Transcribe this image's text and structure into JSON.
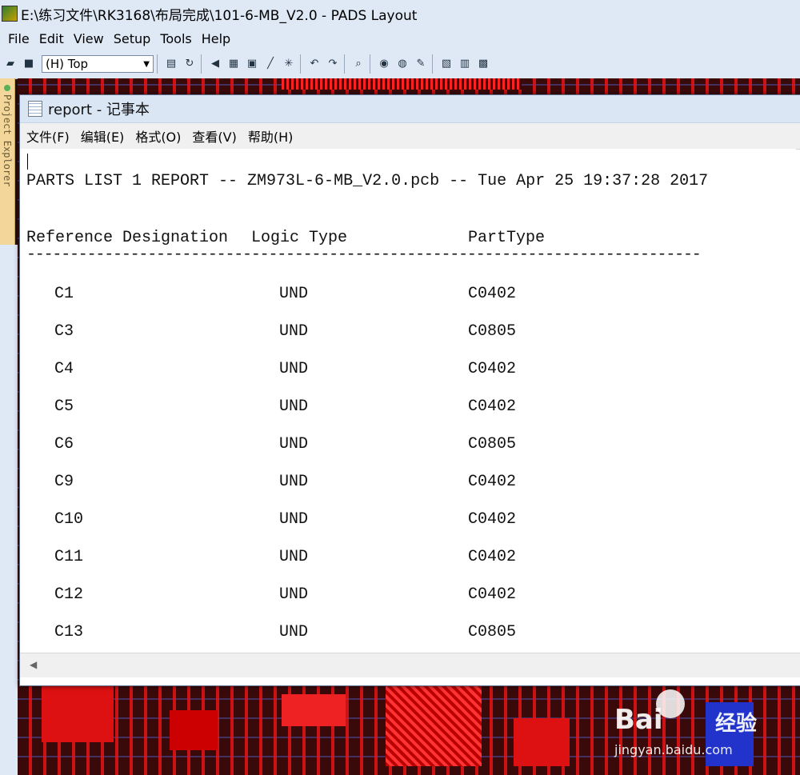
{
  "app": {
    "title": "E:\\练习文件\\RK3168\\布局完成\\101-6-MB_V2.0 - PADS Layout",
    "icon": "pads-app-icon"
  },
  "menu": {
    "file": "File",
    "edit": "Edit",
    "view": "View",
    "setup": "Setup",
    "tools": "Tools",
    "help": "Help"
  },
  "toolbar": {
    "layer_value": "(H) Top"
  },
  "project_explorer": {
    "label": "Project Explorer"
  },
  "notepad": {
    "title": "report - 记事本",
    "menu": [
      "文件(F)",
      "编辑(E)",
      "格式(O)",
      "查看(V)",
      "帮助(H)"
    ],
    "report_title": "PARTS LIST 1 REPORT -- ZM973L-6-MB_V2.0.pcb -- Tue Apr 25 19:37:28 2017",
    "columns": {
      "ref": "Reference Designation",
      "logic": "Logic Type",
      "ptype": "PartType"
    },
    "separator": "------------------------------------------------------------------------------",
    "rows": [
      {
        "ref": "C1",
        "logic": "UND",
        "ptype": "C0402"
      },
      {
        "ref": "C3",
        "logic": "UND",
        "ptype": "C0805"
      },
      {
        "ref": "C4",
        "logic": "UND",
        "ptype": "C0402"
      },
      {
        "ref": "C5",
        "logic": "UND",
        "ptype": "C0402"
      },
      {
        "ref": "C6",
        "logic": "UND",
        "ptype": "C0805"
      },
      {
        "ref": "C9",
        "logic": "UND",
        "ptype": "C0402"
      },
      {
        "ref": "C10",
        "logic": "UND",
        "ptype": "C0402"
      },
      {
        "ref": "C11",
        "logic": "UND",
        "ptype": "C0402"
      },
      {
        "ref": "C12",
        "logic": "UND",
        "ptype": "C0402"
      },
      {
        "ref": "C13",
        "logic": "UND",
        "ptype": "C0805"
      }
    ]
  },
  "watermark": {
    "logo": "Bai",
    "logo_cn": "经验",
    "url": "jingyan.baidu.com"
  },
  "colors": {
    "chrome": "#dfe9f5",
    "pcb_red": "#e61414",
    "pcb_blue": "#5078ff"
  }
}
